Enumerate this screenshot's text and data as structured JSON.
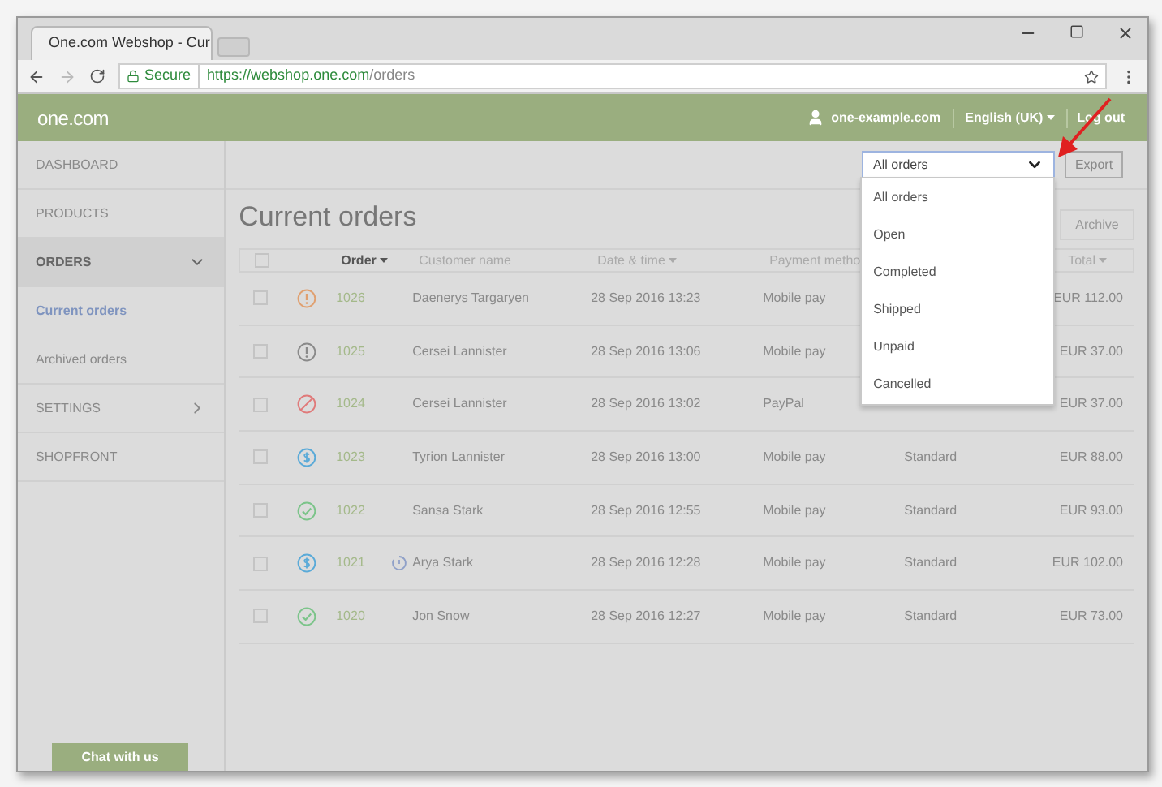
{
  "browser": {
    "tab_title": "One.com Webshop - Cur",
    "secure": "Secure",
    "url_host": "https://webshop.one.com",
    "url_path": "/orders"
  },
  "header": {
    "logo": "one.com",
    "account": "one-example.com",
    "language": "English (UK)",
    "logout": "Log out"
  },
  "sidebar": {
    "items": [
      {
        "label": "DASHBOARD",
        "selected": false
      },
      {
        "label": "PRODUCTS",
        "selected": false
      },
      {
        "label": "ORDERS",
        "selected": true,
        "expanded": true,
        "children": [
          {
            "label": "Current orders",
            "selected": true
          },
          {
            "label": "Archived orders",
            "selected": false
          }
        ]
      },
      {
        "label": "SETTINGS",
        "selected": false,
        "expanded": false
      },
      {
        "label": "SHOPFRONT",
        "selected": false
      }
    ],
    "chat": "Chat with us"
  },
  "toolbar": {
    "filter": {
      "value": "All orders",
      "expanded": true,
      "options": [
        "All orders",
        "Open",
        "Completed",
        "Shipped",
        "Unpaid",
        "Cancelled"
      ]
    },
    "export": "Export"
  },
  "title": "Current orders",
  "archive": "Archive",
  "table": {
    "all_checked": false,
    "columns": [
      {
        "label": "Order",
        "sortable": true,
        "active": true
      },
      {
        "label": "Customer name",
        "sortable": false,
        "active": false
      },
      {
        "label": "Date & time",
        "sortable": true,
        "active": false
      },
      {
        "label": "Payment metho",
        "sortable": false,
        "active": false
      },
      {
        "label": "Total",
        "sortable": true,
        "active": false
      }
    ],
    "rows": [
      {
        "checked": false,
        "kind": "alert",
        "color": "#e0a070",
        "order": "1026",
        "note": false,
        "customer": "Daenerys Targaryen",
        "date": "28 Sep 2016 13:23",
        "payment": "Mobile pay",
        "total": "EUR 112.00"
      },
      {
        "checked": false,
        "kind": "alert",
        "color": "#8a8a8a",
        "order": "1025",
        "note": false,
        "customer": "Cersei Lannister",
        "date": "28 Sep 2016 13:06",
        "payment": "Mobile pay",
        "total": "EUR 37.00"
      },
      {
        "checked": false,
        "kind": "cancelled",
        "color": "#e07a7a",
        "order": "1024",
        "note": false,
        "customer": "Cersei Lannister",
        "date": "28 Sep 2016 13:02",
        "payment": "PayPal",
        "total": "EUR 37.00"
      },
      {
        "checked": false,
        "kind": "paid",
        "color": "#5aaad8",
        "order": "1023",
        "note": false,
        "customer": "Tyrion Lannister",
        "date": "28 Sep 2016 13:00",
        "payment": "Mobile pay",
        "shipping": "Standard",
        "total": "EUR 88.00"
      },
      {
        "checked": false,
        "kind": "completed",
        "color": "#7cc48a",
        "order": "1022",
        "note": false,
        "customer": "Sansa Stark",
        "date": "28 Sep 2016 12:55",
        "payment": "Mobile pay",
        "shipping": "Standard",
        "total": "EUR 93.00"
      },
      {
        "checked": false,
        "kind": "paid",
        "color": "#5aaad8",
        "order": "1021",
        "note": true,
        "customer": "Arya Stark",
        "date": "28 Sep 2016 12:28",
        "payment": "Mobile pay",
        "shipping": "Standard",
        "total": "EUR 102.00"
      },
      {
        "checked": false,
        "kind": "completed",
        "color": "#7cc48a",
        "order": "1020",
        "note": false,
        "customer": "Jon Snow",
        "date": "28 Sep 2016 12:27",
        "payment": "Mobile pay",
        "shipping": "Standard",
        "total": "EUR 73.00"
      }
    ]
  }
}
